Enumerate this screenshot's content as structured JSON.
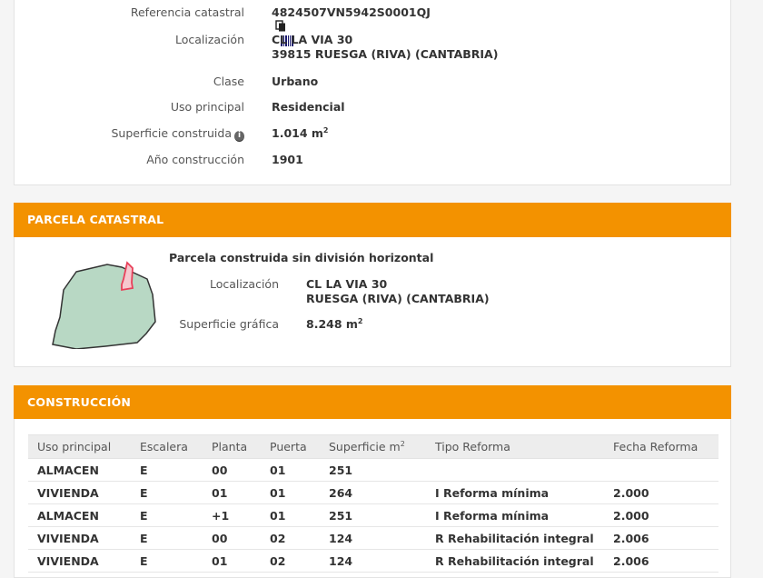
{
  "inmueble": {
    "ref_label": "Referencia catastral",
    "ref_value": "4824507VN5942S0001QJ",
    "loc_label": "Localización",
    "loc_line1": "CL LA VIA 30",
    "loc_line2": "39815 RUESGA (RIVA) (CANTABRIA)",
    "clase_label": "Clase",
    "clase_value": "Urbano",
    "uso_label": "Uso principal",
    "uso_value": "Residencial",
    "sup_label": "Superficie construida",
    "sup_value": "1.014 m",
    "sup_unit_exp": "2",
    "anio_label": "Año construcción",
    "anio_value": "1901"
  },
  "parcela": {
    "header": "PARCELA CATASTRAL",
    "title": "Parcela construida sin división horizontal",
    "loc_label": "Localización",
    "loc_line1": "CL LA VIA 30",
    "loc_line2": "RUESGA (RIVA) (CANTABRIA)",
    "sup_label": "Superficie gráfica",
    "sup_value": "8.248 m",
    "sup_unit_exp": "2"
  },
  "construccion": {
    "header": "CONSTRUCCIÓN",
    "columns": [
      "Uso principal",
      "Escalera",
      "Planta",
      "Puerta",
      "Superficie m",
      "Tipo Reforma",
      "Fecha Reforma"
    ],
    "sup_col_exp": "2",
    "rows": [
      [
        "ALMACEN",
        "E",
        "00",
        "01",
        "251",
        "",
        ""
      ],
      [
        "VIVIENDA",
        "E",
        "01",
        "01",
        "264",
        "I Reforma mínima",
        "2.000"
      ],
      [
        "ALMACEN",
        "E",
        "+1",
        "01",
        "251",
        "I Reforma mínima",
        "2.000"
      ],
      [
        "VIVIENDA",
        "E",
        "00",
        "02",
        "124",
        "R Rehabilitación integral",
        "2.006"
      ],
      [
        "VIVIENDA",
        "E",
        "01",
        "02",
        "124",
        "R Rehabilitación integral",
        "2.006"
      ]
    ]
  },
  "colors": {
    "accent": "#f39200",
    "parcel_fill": "#b8d8c4",
    "building_outline": "#e8405a"
  },
  "icons": [
    "copy-icon",
    "barcode-icon",
    "info-icon"
  ]
}
